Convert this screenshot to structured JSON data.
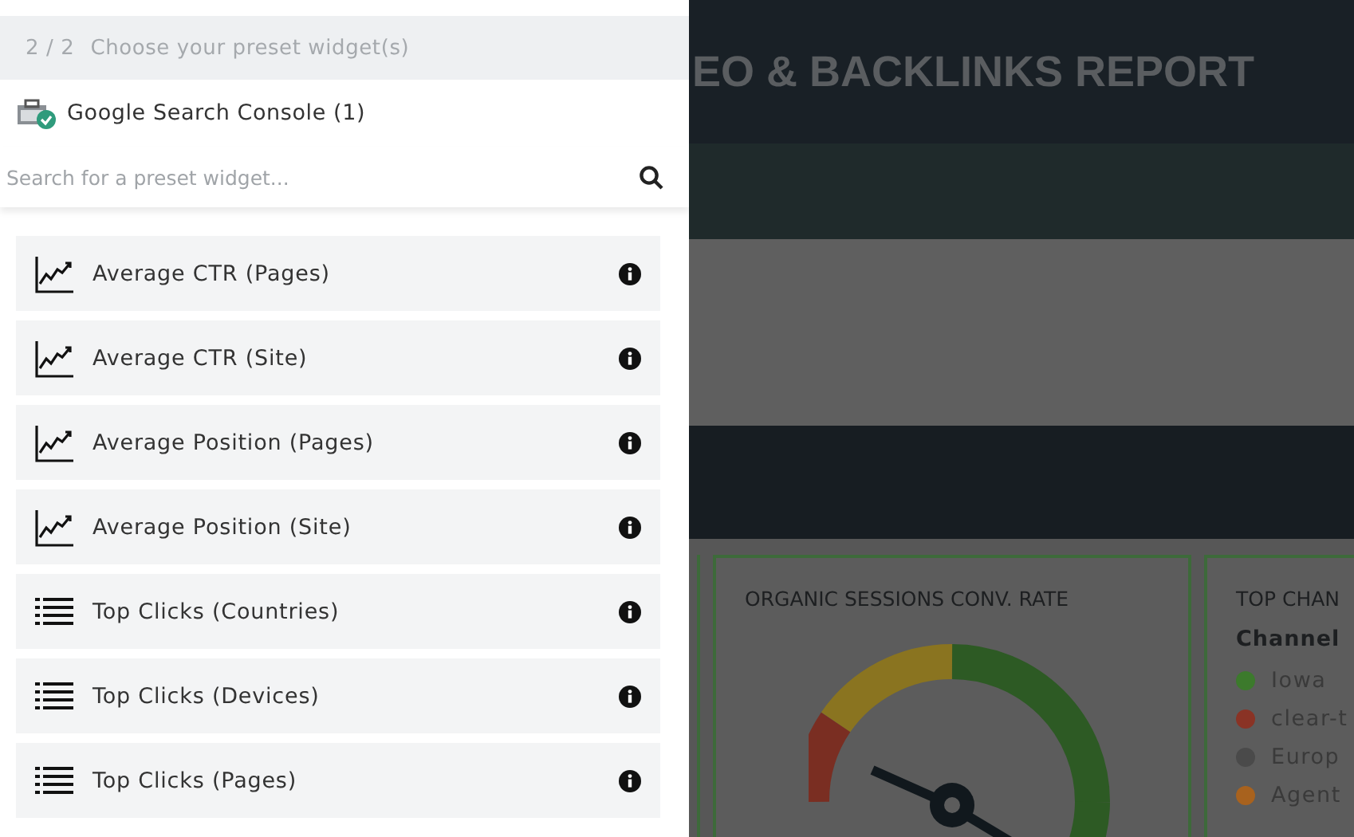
{
  "panel": {
    "step": "2 / 2",
    "title": "Choose your preset widget(s)",
    "source": "Google Search Console (1)",
    "search": {
      "placeholder": "Search for a preset widget..."
    },
    "widgets": [
      {
        "label": "Average CTR (Pages)",
        "kind": "chart"
      },
      {
        "label": "Average CTR (Site)",
        "kind": "chart"
      },
      {
        "label": "Average Position (Pages)",
        "kind": "chart"
      },
      {
        "label": "Average Position (Site)",
        "kind": "chart"
      },
      {
        "label": "Top Clicks (Countries)",
        "kind": "list"
      },
      {
        "label": "Top Clicks (Devices)",
        "kind": "list"
      },
      {
        "label": "Top Clicks (Pages)",
        "kind": "list"
      }
    ]
  },
  "report": {
    "title": "EO & BACKLINKS REPORT",
    "gauge_card": {
      "title": "ORGANIC SESSIONS CONV. RATE"
    },
    "channel_card": {
      "title": "TOP CHAN",
      "subtitle": "Channel",
      "legend": [
        {
          "label": "Iowa",
          "color": "#3c7a2c"
        },
        {
          "label": "clear-t",
          "color": "#8a3325"
        },
        {
          "label": "Europ",
          "color": "#4a4a4a"
        },
        {
          "label": "Agent",
          "color": "#a8621e"
        }
      ]
    }
  }
}
